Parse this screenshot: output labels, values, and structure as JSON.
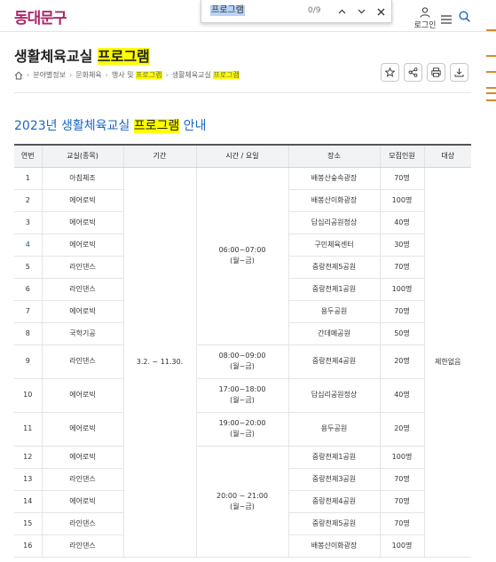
{
  "header": {
    "logo_text": "동대문구",
    "login_label": "로그인"
  },
  "findbar": {
    "query": "프로그램",
    "count": "0/9"
  },
  "page": {
    "title_prefix": "생활체육교실 ",
    "title_highlight": "프로그램",
    "section_title_prefix": "2023년 생활체육교실 ",
    "section_title_highlight": "프로그램",
    "section_title_suffix": " 안내"
  },
  "breadcrumb": {
    "items": [
      "분야별정보",
      "문화체육",
      "행사 및 "
    ],
    "item3_highlight": "프로그램",
    "current_prefix": "생활체육교실 ",
    "current_highlight": "프로그램"
  },
  "table": {
    "headers": [
      "연번",
      "교실(종목)",
      "기간",
      "시간 / 요일",
      "장소",
      "모집인원",
      "대상"
    ],
    "period": "3.2. ~ 11.30.",
    "target": "제한없음",
    "times": {
      "t1": [
        "06:00~07:00",
        "(월~금)"
      ],
      "t2": [
        "08:00~09:00",
        "(월~금)"
      ],
      "t3": [
        "17:00~18:00",
        "(월~금)"
      ],
      "t4": [
        "19:00~20:00",
        "(월~금)"
      ],
      "t5": [
        "20:00 ~ 21:00",
        "(월~금)"
      ]
    },
    "rows": [
      {
        "no": "1",
        "class": "아침체조",
        "place": "배봉산숲속광장",
        "count": "70명"
      },
      {
        "no": "2",
        "class": "에어로빅",
        "place": "배봉산이화광장",
        "count": "100명"
      },
      {
        "no": "3",
        "class": "에어로빅",
        "place": "답십리공원정상",
        "count": "40명"
      },
      {
        "no": "4",
        "class": "에어로빅",
        "place": "구민체육센터",
        "count": "30명"
      },
      {
        "no": "5",
        "class": "라인댄스",
        "place": "중랑천제5공원",
        "count": "70명"
      },
      {
        "no": "6",
        "class": "라인댄스",
        "place": "중랑천제1공원",
        "count": "100명"
      },
      {
        "no": "7",
        "class": "에어로빅",
        "place": "용두공원",
        "count": "70명"
      },
      {
        "no": "8",
        "class": "국학기공",
        "place": "간데메공원",
        "count": "50명"
      },
      {
        "no": "9",
        "class": "라인댄스",
        "place": "중랑천제4공원",
        "count": "20명"
      },
      {
        "no": "10",
        "class": "에어로빅",
        "place": "답십리공원정상",
        "count": "40명"
      },
      {
        "no": "11",
        "class": "에어로빅",
        "place": "용두공원",
        "count": "20명"
      },
      {
        "no": "12",
        "class": "에어로빅",
        "place": "중랑천제1공원",
        "count": "100명"
      },
      {
        "no": "13",
        "class": "라인댄스",
        "place": "중랑천제3공원",
        "count": "70명"
      },
      {
        "no": "14",
        "class": "에어로빅",
        "place": "중랑천제4공원",
        "count": "70명"
      },
      {
        "no": "15",
        "class": "라인댄스",
        "place": "중랑천제5공원",
        "count": "70명"
      },
      {
        "no": "16",
        "class": "라인댄스",
        "place": "배봉산이화광장",
        "count": "100명"
      }
    ]
  },
  "colors": {
    "logo": "#b0246a",
    "section_title": "#1a66c4",
    "find_highlight": "#ffff00"
  }
}
